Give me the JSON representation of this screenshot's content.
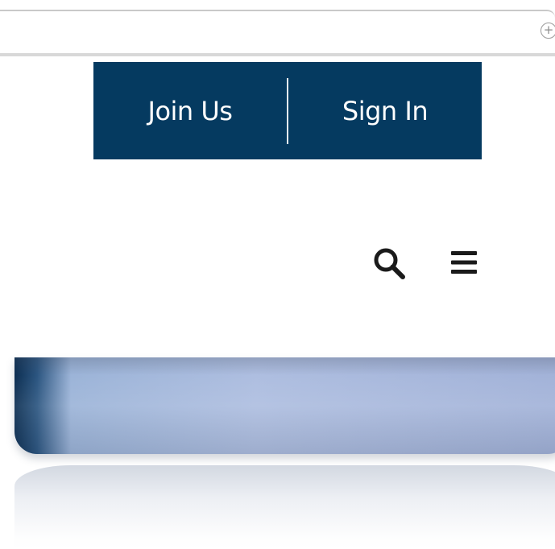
{
  "browser": {
    "zoom_icon": "zoom-in-icon"
  },
  "auth": {
    "join_label": "Join Us",
    "signin_label": "Sign In",
    "background_color": "#053a60"
  },
  "header": {
    "search_icon": "search-icon",
    "menu_icon": "hamburger-menu-icon"
  }
}
